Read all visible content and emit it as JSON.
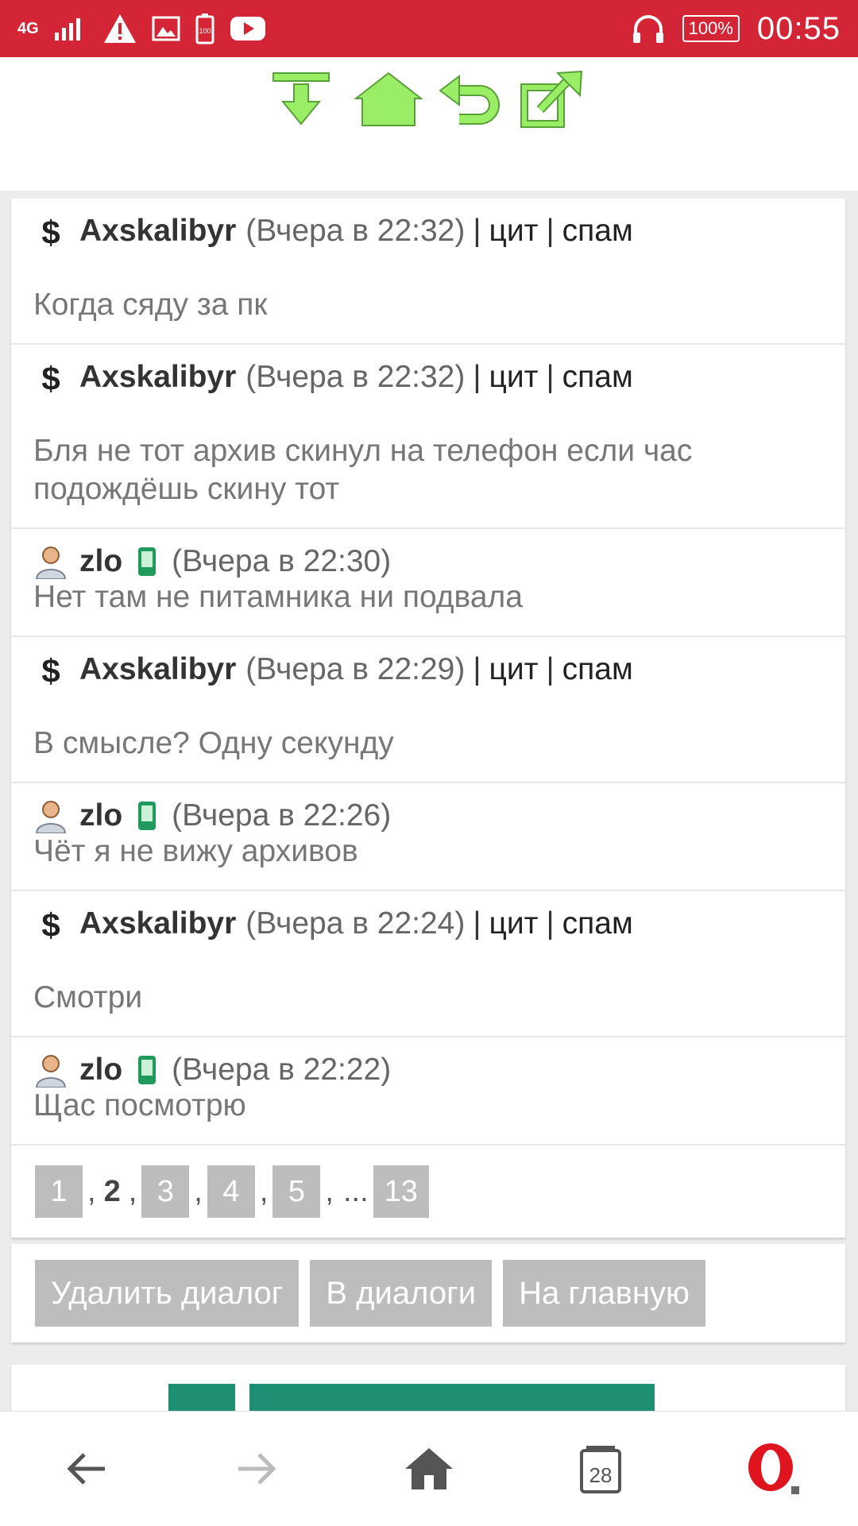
{
  "status_bar": {
    "network": "4G",
    "battery": "100%",
    "battery_icon_text": "100",
    "time": "00:55",
    "colors": {
      "background": "#d32535"
    }
  },
  "toolbar": {
    "icons": [
      "download-icon",
      "home-icon",
      "back-icon",
      "share-icon"
    ],
    "accent_color": "#99ee66"
  },
  "messages": [
    {
      "author": "Axskalibyr",
      "time": "(Вчера в 22:32)",
      "quote": "цит",
      "spam": "спам",
      "text": "Когда сяду за пк",
      "avatar": "dollar-icon",
      "mobile": false
    },
    {
      "author": "Axskalibyr",
      "time": "(Вчера в 22:32)",
      "quote": "цит",
      "spam": "спам",
      "text": "Бля не тот архив скинул на телефон если час подождёшь скину тот",
      "avatar": "dollar-icon",
      "mobile": false
    },
    {
      "author": "zlo",
      "time": "(Вчера в 22:30)",
      "text": "Нет там не питамника ни подвала",
      "avatar": "user-icon",
      "mobile": true
    },
    {
      "author": "Axskalibyr",
      "time": "(Вчера в 22:29)",
      "quote": "цит",
      "spam": "спам",
      "text": "В смысле? Одну секунду",
      "avatar": "dollar-icon",
      "mobile": false
    },
    {
      "author": "zlo",
      "time": "(Вчера в 22:26)",
      "text": "Чёт я не вижу архивов",
      "avatar": "user-icon",
      "mobile": true
    },
    {
      "author": "Axskalibyr",
      "time": "(Вчера в 22:24)",
      "quote": "цит",
      "spam": "спам",
      "text": "Смотри",
      "avatar": "dollar-icon",
      "mobile": false
    },
    {
      "author": "zlo",
      "time": "(Вчера в 22:22)",
      "text": "Щас посмотрю",
      "avatar": "user-icon",
      "mobile": true
    }
  ],
  "separator": "|",
  "pagination": {
    "pages": [
      "1",
      "2",
      "3",
      "4",
      "5",
      "13"
    ],
    "current": "2",
    "ellipsis": "...",
    "comma": ","
  },
  "actions": {
    "delete_dialog": "Удалить диалог",
    "to_dialogs": "В диалоги",
    "to_main": "На главную"
  },
  "bottom_bar": {
    "tabs_count": "28",
    "icons": [
      "back-arrow-icon",
      "forward-arrow-icon",
      "home-icon",
      "tabs-icon",
      "opera-icon"
    ]
  }
}
